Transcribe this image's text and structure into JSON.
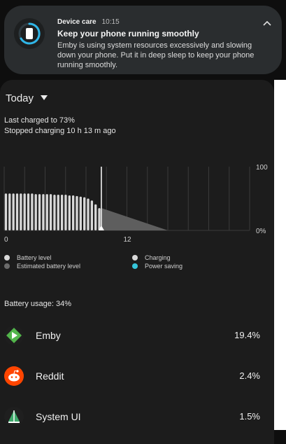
{
  "notification": {
    "app_name": "Device care",
    "time": "10:15",
    "title": "Keep your phone running smoothly",
    "body": "Emby is using system resources excessively and slowing down your phone. Put it in deep sleep to keep your phone running smoothly.",
    "icon": "device-care-icon",
    "collapse_icon": "chevron-up-icon"
  },
  "period": {
    "label": "Today",
    "icon": "caret-down-icon"
  },
  "status": {
    "last_charged": "Last charged to 73%",
    "stopped_charging": "Stopped charging 10 h 13 m ago"
  },
  "chart_data": {
    "type": "bar",
    "x_tick_labels": [
      "0",
      "12"
    ],
    "y_tick_labels": [
      "100",
      "0%"
    ],
    "ylim": [
      0,
      100
    ],
    "battery_level_values": [
      58,
      58,
      58,
      58,
      58,
      58,
      58,
      58,
      57,
      57,
      57,
      57,
      57,
      56,
      56,
      56,
      56,
      55,
      55,
      54,
      53,
      52,
      50,
      47,
      41,
      35
    ],
    "estimated_battery_level": {
      "start": 35,
      "end": 0
    },
    "current_time_marker": 9.5,
    "colors": {
      "battery": "#d8d8d8",
      "estimated": "#5e5e5e",
      "grid": "#3a3a3a",
      "marker": "#ffffff"
    },
    "legend": [
      {
        "label": "Battery level",
        "color": "#d8d8d8"
      },
      {
        "label": "Estimated battery level",
        "color": "#6a6a6a"
      },
      {
        "label": "Charging",
        "color": "#d8d8d8"
      },
      {
        "label": "Power saving",
        "color": "#35c5d9"
      }
    ]
  },
  "usage": {
    "label": "Battery usage: 34%",
    "apps": [
      {
        "name": "Emby",
        "percent": "19.4%",
        "icon": "emby-icon"
      },
      {
        "name": "Reddit",
        "percent": "2.4%",
        "icon": "reddit-icon"
      },
      {
        "name": "System UI",
        "percent": "1.5%",
        "icon": "system-ui-icon"
      }
    ]
  }
}
